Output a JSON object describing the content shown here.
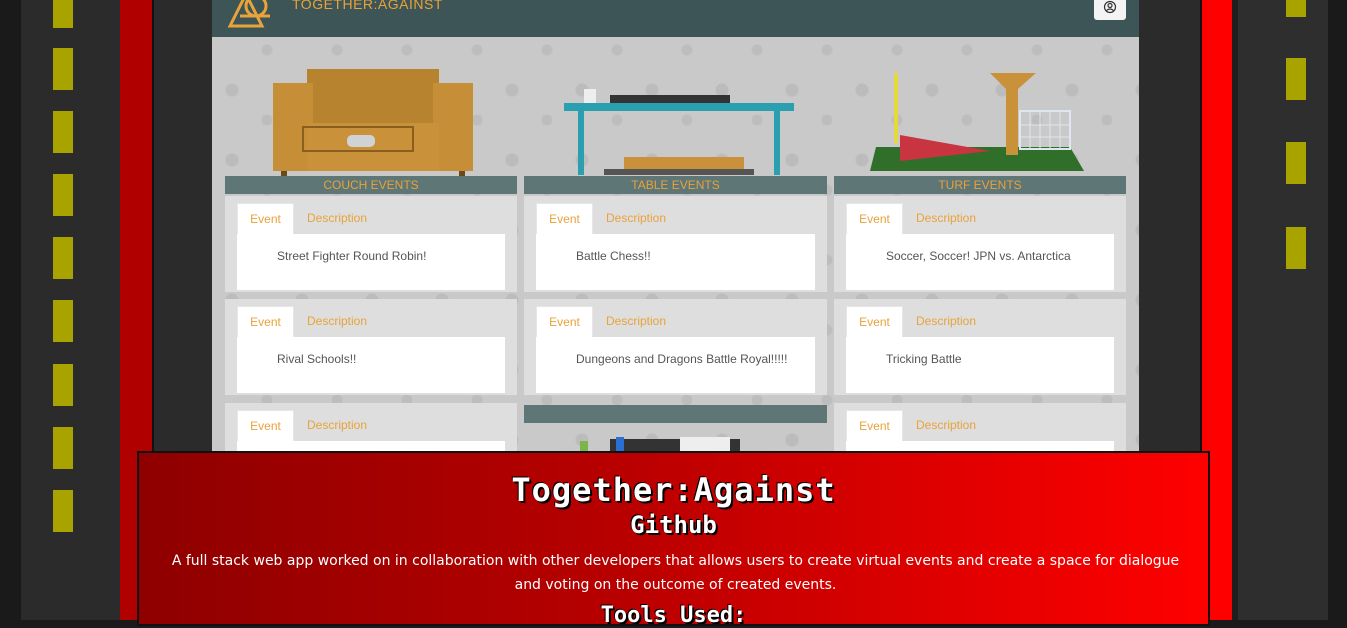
{
  "app": {
    "brand": "TOGETHER:AGAINST",
    "user_button_icon": "user-circle-icon"
  },
  "columns": [
    {
      "header": "COUCH EVENTS",
      "illustration": "couch-illustration",
      "cards": [
        {
          "tab_event": "Event",
          "tab_description": "Description",
          "title": "Street Fighter Round Robin!"
        },
        {
          "tab_event": "Event",
          "tab_description": "Description",
          "title": "Rival Schools!!"
        },
        {
          "tab_event": "Event",
          "tab_description": "Description",
          "title": ""
        }
      ]
    },
    {
      "header": "TABLE EVENTS",
      "illustration": "table-illustration",
      "cards": [
        {
          "tab_event": "Event",
          "tab_description": "Description",
          "title": "Battle Chess!!"
        },
        {
          "tab_event": "Event",
          "tab_description": "Description",
          "title": "Dungeons and Dragons Battle Royal!!!!!"
        }
      ]
    },
    {
      "header": "TURF EVENTS",
      "illustration": "turf-illustration",
      "cards": [
        {
          "tab_event": "Event",
          "tab_description": "Description",
          "title": "Soccer, Soccer! JPN vs. Antarctica"
        },
        {
          "tab_event": "Event",
          "tab_description": "Description",
          "title": "Tricking Battle"
        },
        {
          "tab_event": "Event",
          "tab_description": "Description",
          "title": ""
        }
      ]
    }
  ],
  "project": {
    "title": "Together:Against",
    "link": "Github",
    "description": "A full stack web app worked on in collaboration with other developers that allows users to create virtual events and create a space for dialogue and voting on the outcome of created events.",
    "tools_heading": "Tools Used:"
  },
  "colors": {
    "accent": "#e8a33a",
    "topbar": "#3d5557",
    "red": "#ff0000",
    "dash_yellow": "#a9a300"
  }
}
